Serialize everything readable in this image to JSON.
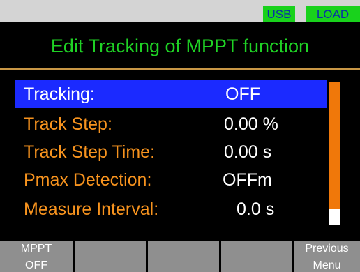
{
  "status": {
    "usb": "USB",
    "load": "LOAD"
  },
  "header": {
    "title": "Edit Tracking of MPPT function"
  },
  "settings": [
    {
      "label": "Tracking:",
      "value": "OFF",
      "selected": true
    },
    {
      "label": "Track Step:",
      "value": "0.00 %",
      "selected": false
    },
    {
      "label": "Track Step Time:",
      "value": "0.00 s",
      "selected": false
    },
    {
      "label": "Pmax Detection:",
      "value": "OFFm",
      "selected": false
    },
    {
      "label": "Measure Interval:",
      "value": "0.0 s",
      "selected": false
    }
  ],
  "soft_keys": [
    {
      "top": "MPPT",
      "bottom": "OFF"
    },
    {
      "top": "",
      "bottom": ""
    },
    {
      "top": "",
      "bottom": ""
    },
    {
      "top": "",
      "bottom": ""
    },
    {
      "top": "Previous",
      "bottom": "Menu"
    }
  ],
  "colors": {
    "title_green": "#1fd225",
    "label_orange": "#f7931e",
    "selection_blue": "#1b2aff",
    "scrollbar_orange": "#f0780a",
    "badge_green": "#19d21c",
    "softkey_gray": "#8f8f8f"
  }
}
